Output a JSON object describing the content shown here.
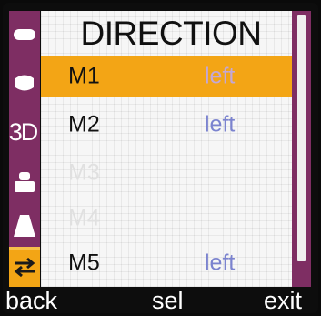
{
  "screen": {
    "title": "DIRECTION",
    "rows": [
      {
        "name": "M1",
        "value": "left",
        "state": "selected"
      },
      {
        "name": "M2",
        "value": "left",
        "state": "normal"
      },
      {
        "name": "M3",
        "value": "",
        "state": "disabled"
      },
      {
        "name": "M4",
        "value": "",
        "state": "disabled"
      },
      {
        "name": "M5",
        "value": "left",
        "state": "normal"
      }
    ]
  },
  "sidebar": {
    "items": [
      {
        "icon": "horizontal-bar-icon",
        "label": ""
      },
      {
        "icon": "round-shape-icon",
        "label": ""
      },
      {
        "icon": "3d-text-icon",
        "label": "3D"
      },
      {
        "icon": "stack-shape-icon",
        "label": ""
      },
      {
        "icon": "trapezoid-icon",
        "label": ""
      },
      {
        "icon": "direction-arrows-icon",
        "label": "",
        "active": true
      }
    ]
  },
  "softkeys": {
    "left": "back",
    "center": "sel",
    "right": "exit"
  },
  "colors": {
    "accent": "#f3a515",
    "sidebar": "#7e2e63",
    "value_text": "#7b83cf",
    "panel_bg": "#f6f6f6"
  }
}
